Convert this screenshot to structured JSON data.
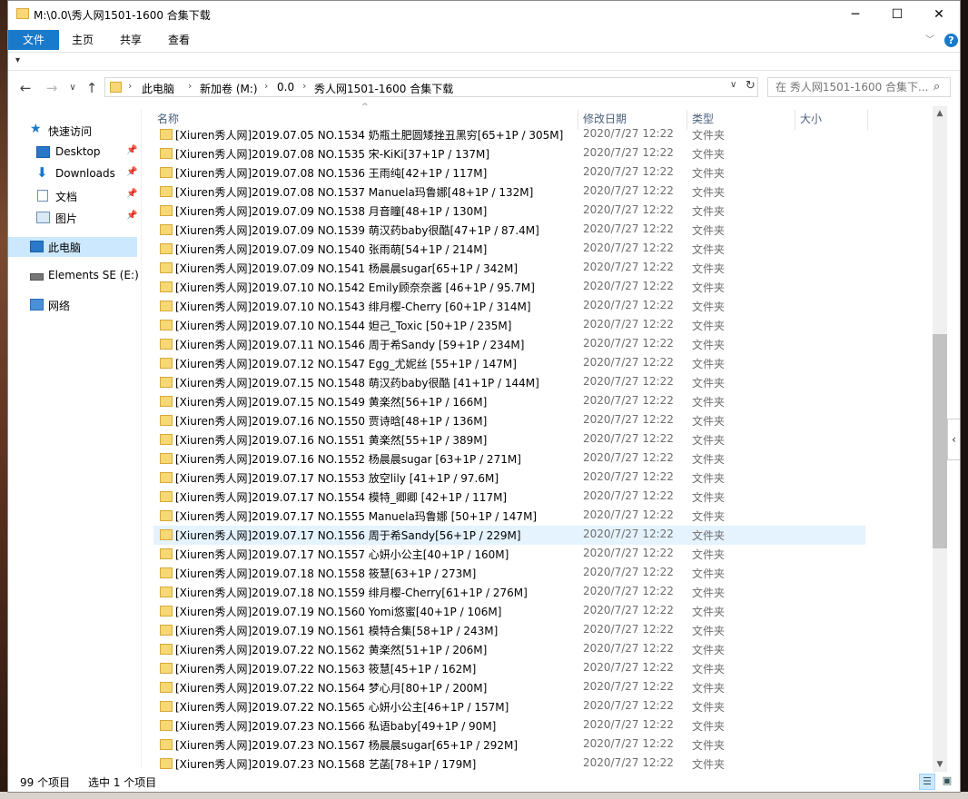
{
  "window": {
    "title": "M:\\0.0\\秀人网1501-1600 合集下载"
  },
  "ribbon": {
    "tabs": [
      "文件",
      "主页",
      "共享",
      "查看"
    ]
  },
  "address": {
    "crumbs": [
      "此电脑",
      "新加卷 (M:)",
      "0.0",
      "秀人网1501-1600 合集下载"
    ]
  },
  "search": {
    "placeholder": "在 秀人网1501-1600 合集下..."
  },
  "sidebar": {
    "quick_access": "快速访问",
    "desktop": "Desktop",
    "downloads": "Downloads",
    "documents": "文档",
    "pictures": "图片",
    "this_pc": "此电脑",
    "drive": "Elements SE (E:)",
    "network": "网络"
  },
  "columns": {
    "name": "名称",
    "date": "修改日期",
    "type": "类型",
    "size": "大小"
  },
  "files": [
    {
      "name": "[Xiuren秀人网]2019.07.05 NO.1534 奶瓶土肥圆矮挫丑黑穷[65+1P / 305M]",
      "date": "2020/7/27 12:22",
      "type": "文件夹"
    },
    {
      "name": "[Xiuren秀人网]2019.07.08 NO.1535 宋-KiKi[37+1P / 137M]",
      "date": "2020/7/27 12:22",
      "type": "文件夹"
    },
    {
      "name": "[Xiuren秀人网]2019.07.08 NO.1536 王雨纯[42+1P / 117M]",
      "date": "2020/7/27 12:22",
      "type": "文件夹"
    },
    {
      "name": "[Xiuren秀人网]2019.07.08 NO.1537 Manuela玛鲁娜[48+1P / 132M]",
      "date": "2020/7/27 12:22",
      "type": "文件夹"
    },
    {
      "name": "[Xiuren秀人网]2019.07.09 NO.1538 月音瞳[48+1P / 130M]",
      "date": "2020/7/27 12:22",
      "type": "文件夹"
    },
    {
      "name": "[Xiuren秀人网]2019.07.09 NO.1539 萌汉药baby很酷[47+1P / 87.4M]",
      "date": "2020/7/27 12:22",
      "type": "文件夹"
    },
    {
      "name": "[Xiuren秀人网]2019.07.09 NO.1540 张雨萌[54+1P / 214M]",
      "date": "2020/7/27 12:22",
      "type": "文件夹"
    },
    {
      "name": "[Xiuren秀人网]2019.07.09 NO.1541 杨晨晨sugar[65+1P / 342M]",
      "date": "2020/7/27 12:22",
      "type": "文件夹"
    },
    {
      "name": "[Xiuren秀人网]2019.07.10 NO.1542 Emily顾奈奈酱 [46+1P / 95.7M]",
      "date": "2020/7/27 12:22",
      "type": "文件夹"
    },
    {
      "name": "[Xiuren秀人网]2019.07.10 NO.1543 绯月樱-Cherry [60+1P / 314M]",
      "date": "2020/7/27 12:22",
      "type": "文件夹"
    },
    {
      "name": "[Xiuren秀人网]2019.07.10 NO.1544 妲己_Toxic [50+1P / 235M]",
      "date": "2020/7/27 12:22",
      "type": "文件夹"
    },
    {
      "name": "[Xiuren秀人网]2019.07.11 NO.1546 周于希Sandy [59+1P / 234M]",
      "date": "2020/7/27 12:22",
      "type": "文件夹"
    },
    {
      "name": "[Xiuren秀人网]2019.07.12 NO.1547 Egg_尤妮丝 [55+1P / 147M]",
      "date": "2020/7/27 12:22",
      "type": "文件夹"
    },
    {
      "name": "[Xiuren秀人网]2019.07.15 NO.1548 萌汉药baby很酷 [41+1P / 144M]",
      "date": "2020/7/27 12:22",
      "type": "文件夹"
    },
    {
      "name": "[Xiuren秀人网]2019.07.15 NO.1549 黄楽然[56+1P / 166M]",
      "date": "2020/7/27 12:22",
      "type": "文件夹"
    },
    {
      "name": "[Xiuren秀人网]2019.07.16 NO.1550 贾诗晗[48+1P / 136M]",
      "date": "2020/7/27 12:22",
      "type": "文件夹"
    },
    {
      "name": "[Xiuren秀人网]2019.07.16 NO.1551 黄楽然[55+1P / 389M]",
      "date": "2020/7/27 12:22",
      "type": "文件夹"
    },
    {
      "name": "[Xiuren秀人网]2019.07.16 NO.1552 杨晨晨sugar [63+1P / 271M]",
      "date": "2020/7/27 12:22",
      "type": "文件夹"
    },
    {
      "name": "[Xiuren秀人网]2019.07.17 NO.1553 放空lily [41+1P / 97.6M]",
      "date": "2020/7/27 12:22",
      "type": "文件夹"
    },
    {
      "name": "[Xiuren秀人网]2019.07.17 NO.1554 模特_卿卿 [42+1P / 117M]",
      "date": "2020/7/27 12:22",
      "type": "文件夹"
    },
    {
      "name": "[Xiuren秀人网]2019.07.17 NO.1555 Manuela玛鲁娜 [50+1P / 147M]",
      "date": "2020/7/27 12:22",
      "type": "文件夹"
    },
    {
      "name": "[Xiuren秀人网]2019.07.17 NO.1556 周于希Sandy[56+1P / 229M]",
      "date": "2020/7/27 12:22",
      "type": "文件夹"
    },
    {
      "name": "[Xiuren秀人网]2019.07.17 NO.1557 心妍小公主[40+1P / 160M]",
      "date": "2020/7/27 12:22",
      "type": "文件夹"
    },
    {
      "name": "[Xiuren秀人网]2019.07.18 NO.1558 筱慧[63+1P / 273M]",
      "date": "2020/7/27 12:22",
      "type": "文件夹"
    },
    {
      "name": "[Xiuren秀人网]2019.07.18 NO.1559 绯月樱-Cherry[61+1P / 276M]",
      "date": "2020/7/27 12:22",
      "type": "文件夹"
    },
    {
      "name": "[Xiuren秀人网]2019.07.19 NO.1560 Yomi悠蜜[40+1P / 106M]",
      "date": "2020/7/27 12:22",
      "type": "文件夹"
    },
    {
      "name": "[Xiuren秀人网]2019.07.19 NO.1561 模特合集[58+1P / 243M]",
      "date": "2020/7/27 12:22",
      "type": "文件夹"
    },
    {
      "name": "[Xiuren秀人网]2019.07.22 NO.1562 黄楽然[51+1P / 206M]",
      "date": "2020/7/27 12:22",
      "type": "文件夹"
    },
    {
      "name": "[Xiuren秀人网]2019.07.22 NO.1563 筱慧[45+1P / 162M]",
      "date": "2020/7/27 12:22",
      "type": "文件夹"
    },
    {
      "name": "[Xiuren秀人网]2019.07.22 NO.1564 梦心月[80+1P / 200M]",
      "date": "2020/7/27 12:22",
      "type": "文件夹"
    },
    {
      "name": "[Xiuren秀人网]2019.07.22 NO.1565 心妍小公主[46+1P / 157M]",
      "date": "2020/7/27 12:22",
      "type": "文件夹"
    },
    {
      "name": "[Xiuren秀人网]2019.07.23 NO.1566 私语baby[49+1P / 90M]",
      "date": "2020/7/27 12:22",
      "type": "文件夹"
    },
    {
      "name": "[Xiuren秀人网]2019.07.23 NO.1567 杨晨晨sugar[65+1P / 292M]",
      "date": "2020/7/27 12:22",
      "type": "文件夹"
    },
    {
      "name": "[Xiuren秀人网]2019.07.23 NO.1568 艺菡[78+1P / 179M]",
      "date": "2020/7/27 12:22",
      "type": "文件夹"
    }
  ],
  "hovered_index": 21,
  "status": {
    "count": "99 个项目",
    "selected": "选中 1 个项目"
  },
  "colors": {
    "accent": "#1979ca",
    "selection": "#cce8ff",
    "hover": "#e5f3ff",
    "folder": "#f8d775"
  }
}
